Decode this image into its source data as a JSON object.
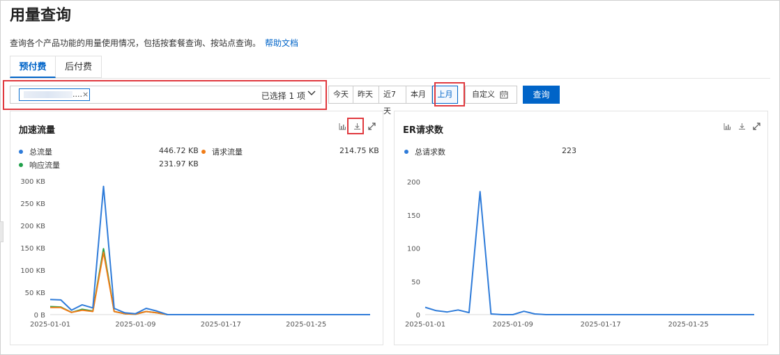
{
  "page": {
    "title": "用量查询",
    "subtitle": "查询各个产品功能的用量使用情况，包括按套餐查询、按站点查询。",
    "help_link": "帮助文档"
  },
  "tabs": [
    {
      "label": "预付费",
      "active": true
    },
    {
      "label": "后付费",
      "active": false
    }
  ],
  "site_select": {
    "chip_text": "....",
    "chip_remove": "×",
    "selected_count": "已选择 1 项"
  },
  "time_buttons": [
    {
      "label": "今天",
      "selected": false
    },
    {
      "label": "昨天",
      "selected": false
    },
    {
      "label": "近7天",
      "selected": false
    },
    {
      "label": "本月",
      "selected": false
    },
    {
      "label": "上月",
      "selected": true
    }
  ],
  "custom_range": {
    "label": "自定义"
  },
  "query_button": {
    "label": "查询"
  },
  "colors": {
    "accent": "#0064c8",
    "series_blue": "#2e7bd9",
    "series_orange": "#f07c17",
    "series_green": "#20a04a",
    "highlight": "#e0393e"
  },
  "charts": {
    "left": {
      "title": "加速流量",
      "tools": [
        "bar-chart-icon",
        "download-icon",
        "fullscreen-icon"
      ],
      "legend": [
        {
          "name": "总流量",
          "value": "446.72 KB",
          "color": "#2e7bd9"
        },
        {
          "name": "请求流量",
          "value": "214.75 KB",
          "color": "#f07c17"
        },
        {
          "name": "响应流量",
          "value": "231.97 KB",
          "color": "#20a04a"
        }
      ]
    },
    "right": {
      "title": "ER请求数",
      "tools": [
        "bar-chart-icon",
        "download-icon",
        "fullscreen-icon"
      ],
      "legend": [
        {
          "name": "总请求数",
          "value": "223",
          "color": "#2e7bd9"
        }
      ]
    }
  },
  "chart_data": [
    {
      "type": "line",
      "title": "加速流量",
      "y_unit": "KB",
      "x_ticks": [
        "2025-01-01",
        "2025-01-09",
        "2025-01-17",
        "2025-01-25"
      ],
      "y_ticks": [
        "0 B",
        "50 KB",
        "100 KB",
        "150 KB",
        "200 KB",
        "250 KB",
        "300 KB"
      ],
      "ylim": [
        0,
        300
      ],
      "x": [
        "2025-01-01",
        "2025-01-02",
        "2025-01-03",
        "2025-01-04",
        "2025-01-05",
        "2025-01-06",
        "2025-01-07",
        "2025-01-08",
        "2025-01-09",
        "2025-01-10",
        "2025-01-11",
        "2025-01-12",
        "2025-01-13",
        "2025-01-14",
        "2025-01-15",
        "2025-01-16",
        "2025-01-17",
        "2025-01-18",
        "2025-01-19",
        "2025-01-20",
        "2025-01-21",
        "2025-01-22",
        "2025-01-23",
        "2025-01-24",
        "2025-01-25",
        "2025-01-26",
        "2025-01-27",
        "2025-01-28",
        "2025-01-29",
        "2025-01-30",
        "2025-01-31"
      ],
      "series": [
        {
          "name": "总流量",
          "color": "#2e7bd9",
          "values": [
            34,
            33,
            10,
            22,
            15,
            288,
            14,
            4,
            2,
            14,
            8,
            0,
            0,
            0,
            0,
            0,
            0,
            0,
            0,
            0,
            0,
            0,
            0,
            0,
            0,
            0,
            0,
            0,
            0,
            0,
            0
          ]
        },
        {
          "name": "请求流量",
          "color": "#f07c17",
          "values": [
            16,
            16,
            5,
            10,
            7,
            140,
            7,
            2,
            1,
            7,
            4,
            0,
            0,
            0,
            0,
            0,
            0,
            0,
            0,
            0,
            0,
            0,
            0,
            0,
            0,
            0,
            0,
            0,
            0,
            0,
            0
          ]
        },
        {
          "name": "响应流量",
          "color": "#20a04a",
          "values": [
            18,
            17,
            5,
            12,
            8,
            148,
            7,
            2,
            1,
            7,
            4,
            0,
            0,
            0,
            0,
            0,
            0,
            0,
            0,
            0,
            0,
            0,
            0,
            0,
            0,
            0,
            0,
            0,
            0,
            0,
            0
          ]
        }
      ]
    },
    {
      "type": "line",
      "title": "ER请求数",
      "x_ticks": [
        "2025-01-01",
        "2025-01-09",
        "2025-01-17",
        "2025-01-25"
      ],
      "y_ticks": [
        "0",
        "50",
        "100",
        "150",
        "200"
      ],
      "ylim": [
        0,
        200
      ],
      "x": [
        "2025-01-01",
        "2025-01-02",
        "2025-01-03",
        "2025-01-04",
        "2025-01-05",
        "2025-01-06",
        "2025-01-07",
        "2025-01-08",
        "2025-01-09",
        "2025-01-10",
        "2025-01-11",
        "2025-01-12",
        "2025-01-13",
        "2025-01-14",
        "2025-01-15",
        "2025-01-16",
        "2025-01-17",
        "2025-01-18",
        "2025-01-19",
        "2025-01-20",
        "2025-01-21",
        "2025-01-22",
        "2025-01-23",
        "2025-01-24",
        "2025-01-25",
        "2025-01-26",
        "2025-01-27",
        "2025-01-28",
        "2025-01-29",
        "2025-01-30",
        "2025-01-31"
      ],
      "series": [
        {
          "name": "总请求数",
          "color": "#2e7bd9",
          "values": [
            11,
            6,
            4,
            7,
            3,
            185,
            1,
            0,
            0,
            5,
            1,
            0,
            0,
            0,
            0,
            0,
            0,
            0,
            0,
            0,
            0,
            0,
            0,
            0,
            0,
            0,
            0,
            0,
            0,
            0,
            0
          ]
        }
      ]
    }
  ]
}
